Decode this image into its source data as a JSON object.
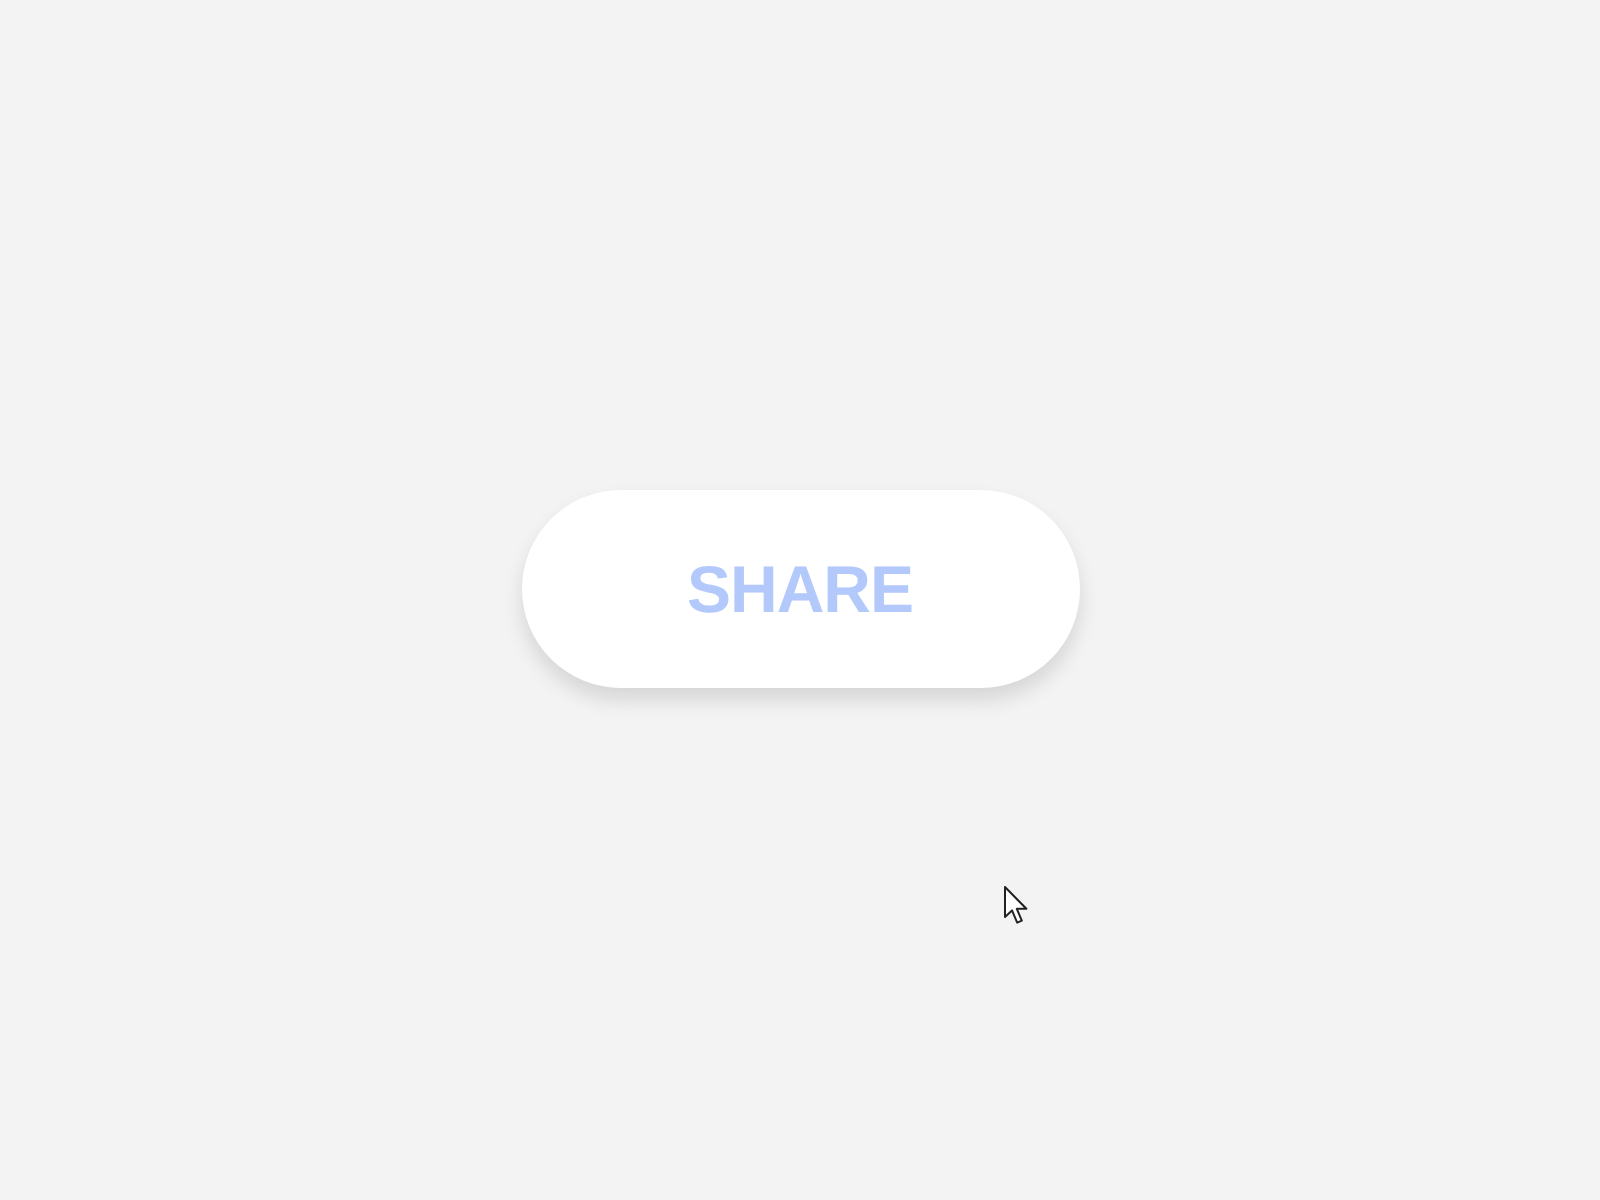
{
  "button": {
    "label": "SHARE"
  }
}
